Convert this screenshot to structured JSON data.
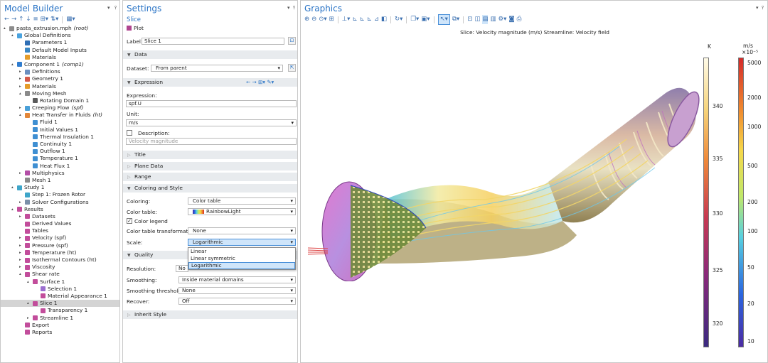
{
  "model_builder": {
    "title": "Model Builder",
    "toolbar_icons": [
      "arrow-left-icon",
      "arrow-right-icon",
      "arrow-up-icon",
      "arrow-down-icon",
      "tree-collapse-icon",
      "tree-expand-icon",
      "sort-icon",
      "grid-icon"
    ],
    "tree": [
      {
        "label": "pasta_extrusion.mph",
        "suffix": "(root)",
        "depth": 0,
        "toggle": "▴",
        "icon": "#8c8c8c",
        "name": "root"
      },
      {
        "label": "Global Definitions",
        "depth": 1,
        "toggle": "▴",
        "icon": "#4aa3df",
        "name": "global-definitions"
      },
      {
        "label": "Parameters 1",
        "depth": 2,
        "icon": "#2f6fb5",
        "name": "parameters-1"
      },
      {
        "label": "Default Model Inputs",
        "depth": 2,
        "icon": "#3b87c4",
        "name": "default-model-inputs"
      },
      {
        "label": "Materials",
        "depth": 2,
        "icon": "#e59c2a",
        "name": "materials-global"
      },
      {
        "label": "Component 1",
        "suffix": "(comp1)",
        "depth": 1,
        "toggle": "▴",
        "icon": "#2f7ccf",
        "name": "component-1"
      },
      {
        "label": "Definitions",
        "depth": 2,
        "toggle": "▸",
        "icon": "#6b8fc0",
        "name": "definitions"
      },
      {
        "label": "Geometry 1",
        "depth": 2,
        "toggle": "▸",
        "icon": "#d45a4a",
        "name": "geometry-1"
      },
      {
        "label": "Materials",
        "depth": 2,
        "toggle": "▸",
        "icon": "#e59c2a",
        "name": "materials"
      },
      {
        "label": "Moving Mesh",
        "depth": 2,
        "toggle": "▴",
        "icon": "#8a8a8a",
        "name": "moving-mesh"
      },
      {
        "label": "Rotating Domain 1",
        "depth": 3,
        "icon": "#5a5a5a",
        "name": "rotating-domain-1"
      },
      {
        "label": "Creeping Flow",
        "suffix": "(spf)",
        "depth": 2,
        "toggle": "▸",
        "icon": "#4aa0d8",
        "name": "creeping-flow"
      },
      {
        "label": "Heat Transfer in Fluids",
        "suffix": "(ht)",
        "depth": 2,
        "toggle": "▴",
        "icon": "#e2873a",
        "name": "heat-transfer-in-fluids"
      },
      {
        "label": "Fluid 1",
        "depth": 3,
        "icon": "#3f8fd2",
        "name": "fluid-1"
      },
      {
        "label": "Initial Values 1",
        "depth": 3,
        "icon": "#3f8fd2",
        "name": "initial-values-1"
      },
      {
        "label": "Thermal Insulation 1",
        "depth": 3,
        "icon": "#3f8fd2",
        "name": "thermal-insulation-1"
      },
      {
        "label": "Continuity 1",
        "depth": 3,
        "icon": "#3f8fd2",
        "name": "continuity-1"
      },
      {
        "label": "Outflow 1",
        "depth": 3,
        "icon": "#3f8fd2",
        "name": "outflow-1"
      },
      {
        "label": "Temperature 1",
        "depth": 3,
        "icon": "#3f8fd2",
        "name": "temperature-1"
      },
      {
        "label": "Heat Flux 1",
        "depth": 3,
        "icon": "#3f8fd2",
        "name": "heat-flux-1"
      },
      {
        "label": "Multiphysics",
        "depth": 2,
        "toggle": "▸",
        "icon": "#b34ea6",
        "name": "multiphysics"
      },
      {
        "label": "Mesh 1",
        "depth": 2,
        "icon": "#8a8a8a",
        "name": "mesh-1"
      },
      {
        "label": "Study 1",
        "depth": 1,
        "toggle": "▴",
        "icon": "#3ea5c9",
        "name": "study-1"
      },
      {
        "label": "Step 1: Frozen Rotor",
        "depth": 2,
        "icon": "#3ea5c9",
        "name": "step-1-frozen-rotor"
      },
      {
        "label": "Solver Configurations",
        "depth": 2,
        "toggle": "▸",
        "icon": "#7a8fa8",
        "name": "solver-configurations"
      },
      {
        "label": "Results",
        "depth": 1,
        "toggle": "▴",
        "icon": "#c24d9b",
        "name": "results"
      },
      {
        "label": "Datasets",
        "depth": 2,
        "toggle": "▸",
        "icon": "#c24d9b",
        "name": "datasets"
      },
      {
        "label": "Derived Values",
        "depth": 2,
        "icon": "#c24d9b",
        "name": "derived-values"
      },
      {
        "label": "Tables",
        "depth": 2,
        "icon": "#c24d9b",
        "name": "tables"
      },
      {
        "label": "Velocity (spf)",
        "depth": 2,
        "toggle": "▸",
        "icon": "#c24d9b",
        "name": "velocity-spf"
      },
      {
        "label": "Pressure (spf)",
        "depth": 2,
        "toggle": "▸",
        "icon": "#c24d9b",
        "name": "pressure-spf"
      },
      {
        "label": "Temperature (ht)",
        "depth": 2,
        "toggle": "▸",
        "icon": "#c24d9b",
        "name": "temperature-ht"
      },
      {
        "label": "Isothermal Contours (ht)",
        "depth": 2,
        "toggle": "▸",
        "icon": "#c24d9b",
        "name": "isothermal-contours-ht"
      },
      {
        "label": "Viscosity",
        "depth": 2,
        "toggle": "▸",
        "icon": "#c24d9b",
        "name": "viscosity"
      },
      {
        "label": "Shear rate",
        "depth": 2,
        "toggle": "▴",
        "icon": "#c24d9b",
        "name": "shear-rate"
      },
      {
        "label": "Surface 1",
        "depth": 3,
        "toggle": "▴",
        "icon": "#c24d9b",
        "name": "surface-1"
      },
      {
        "label": "Selection 1",
        "depth": 4,
        "icon": "#9b6ed0",
        "name": "selection-1"
      },
      {
        "label": "Material Appearance 1",
        "depth": 4,
        "icon": "#c24d9b",
        "name": "material-appearance-1"
      },
      {
        "label": "Slice 1",
        "depth": 3,
        "toggle": "▴",
        "icon": "#c24d9b",
        "name": "slice-1",
        "selected": true
      },
      {
        "label": "Transparency 1",
        "depth": 4,
        "icon": "#c24d9b",
        "name": "transparency-1"
      },
      {
        "label": "Streamline 1",
        "depth": 3,
        "toggle": "▸",
        "icon": "#c24d9b",
        "name": "streamline-1"
      },
      {
        "label": "Export",
        "depth": 2,
        "icon": "#c24d9b",
        "name": "export"
      },
      {
        "label": "Reports",
        "depth": 2,
        "icon": "#c24d9b",
        "name": "reports"
      }
    ]
  },
  "settings": {
    "title": "Settings",
    "node_type": "Slice",
    "plot_button": "Plot",
    "label_caption": "Label:",
    "label_value": "Slice 1",
    "data_section": "Data",
    "dataset_caption": "Dataset:",
    "dataset_value": "From parent",
    "expression_section": "Expression",
    "expression_caption": "Expression:",
    "expression_value": "spf.U",
    "unit_caption": "Unit:",
    "unit_value": "m/s",
    "description_caption": "Description:",
    "description_placeholder": "Velocity magnitude",
    "title_section": "Title",
    "plane_data_section": "Plane Data",
    "range_section": "Range",
    "coloring_section": "Coloring and Style",
    "coloring_caption": "Coloring:",
    "coloring_value": "Color table",
    "color_table_caption": "Color table:",
    "color_table_value": "RainbowLight",
    "color_legend_label": "Color legend",
    "transform_caption": "Color table transformation:",
    "transform_value": "None",
    "scale_caption": "Scale:",
    "scale_value": "Logarithmic",
    "scale_options": [
      "Linear",
      "Linear symmetric",
      "Logarithmic"
    ],
    "quality_section": "Quality",
    "resolution_caption": "Resolution:",
    "resolution_value": "No",
    "smoothing_caption": "Smoothing:",
    "smoothing_value": "Inside material domains",
    "smoothing_threshold_caption": "Smoothing threshold:",
    "smoothing_threshold_value": "None",
    "recover_caption": "Recover:",
    "recover_value": "Off",
    "inherit_section": "Inherit Style"
  },
  "graphics": {
    "title": "Graphics",
    "plot_title": "Slice: Velocity magnitude (m/s) Streamline: Velocity field",
    "temp_legend": {
      "unit": "K",
      "ticks": [
        {
          "label": "340",
          "pos": 0.17
        },
        {
          "label": "335",
          "pos": 0.35
        },
        {
          "label": "330",
          "pos": 0.54
        },
        {
          "label": "325",
          "pos": 0.735
        },
        {
          "label": "320",
          "pos": 0.92
        }
      ]
    },
    "vel_legend": {
      "unit": "m/s",
      "multiplier": "×10⁻⁵",
      "ticks": [
        {
          "label": "5000",
          "pos": 0.02
        },
        {
          "label": "2000",
          "pos": 0.14
        },
        {
          "label": "1000",
          "pos": 0.24
        },
        {
          "label": "500",
          "pos": 0.375
        },
        {
          "label": "200",
          "pos": 0.5
        },
        {
          "label": "100",
          "pos": 0.6
        },
        {
          "label": "50",
          "pos": 0.725
        },
        {
          "label": "20",
          "pos": 0.85
        },
        {
          "label": "10",
          "pos": 0.98
        }
      ]
    }
  },
  "colors": {
    "accent": "#2a74c6",
    "selection": "#cfe5fa"
  }
}
